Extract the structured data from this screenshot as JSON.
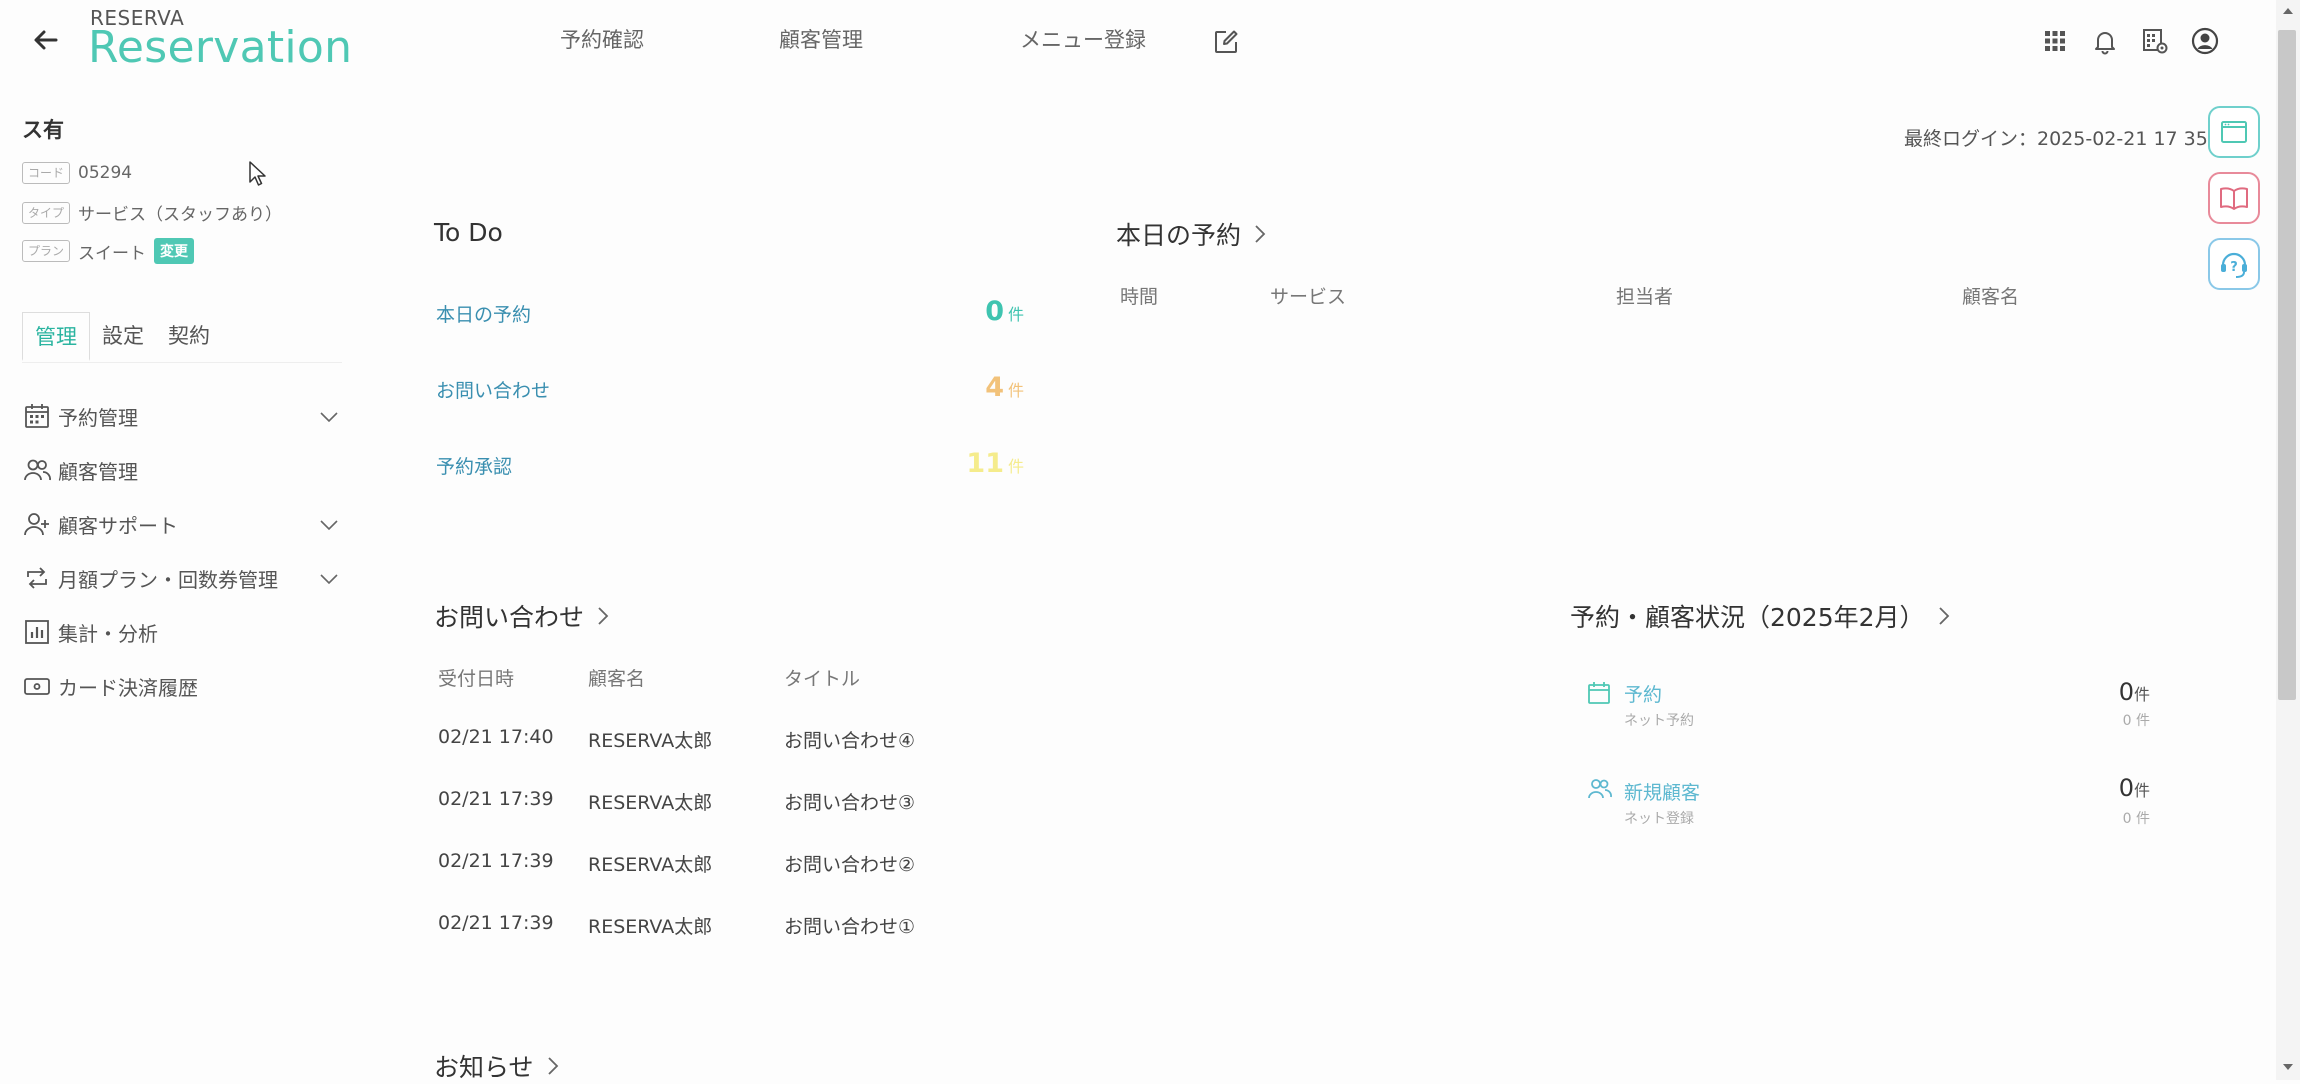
{
  "header": {
    "brand_small": "RESERVA",
    "brand_large": "Reservation",
    "nav": [
      "予約確認",
      "顧客管理",
      "メニュー登録"
    ]
  },
  "sidebar": {
    "shop_name": "ス有",
    "code_tag": "コード",
    "code_value": "05294",
    "type_tag": "タイプ",
    "type_value": "サービス（スタッフあり）",
    "plan_tag": "プラン",
    "plan_value": "スイート",
    "change_label": "変更",
    "tabs": [
      "管理",
      "設定",
      "契約"
    ],
    "menu": [
      {
        "label": "予約管理"
      },
      {
        "label": "顧客管理"
      },
      {
        "label": "顧客サポート"
      },
      {
        "label": "月額プラン・回数券管理"
      },
      {
        "label": "集計・分析"
      },
      {
        "label": "カード決済履歴"
      }
    ]
  },
  "main": {
    "last_login": "最終ログイン：2025-02-21 17 35",
    "todo": {
      "title": "To Do",
      "unit": "件",
      "items": [
        {
          "label": "本日の予約",
          "count": "0",
          "color": "#3fc4b0"
        },
        {
          "label": "お問い合わせ",
          "count": "4",
          "color": "#f2c27a"
        },
        {
          "label": "予約承認",
          "count": "11",
          "color": "#f5ec8c"
        }
      ]
    },
    "today": {
      "title": "本日の予約",
      "columns": [
        "時間",
        "サービス",
        "担当者",
        "顧客名"
      ]
    },
    "inquiries": {
      "title": "お問い合わせ",
      "columns": [
        "受付日時",
        "顧客名",
        "タイトル"
      ],
      "rows": [
        [
          "02/21 17:40",
          "RESERVA太郎",
          "お問い合わせ④"
        ],
        [
          "02/21 17:39",
          "RESERVA太郎",
          "お問い合わせ③"
        ],
        [
          "02/21 17:39",
          "RESERVA太郎",
          "お問い合わせ②"
        ],
        [
          "02/21 17:39",
          "RESERVA太郎",
          "お問い合わせ①"
        ]
      ]
    },
    "status": {
      "title": "予約・顧客状況（2025年2月）",
      "items": [
        {
          "label": "予約",
          "sub": "ネット予約",
          "count": "0",
          "unit": "件",
          "sub_count": "0 件"
        },
        {
          "label": "新規顧客",
          "sub": "ネット登録",
          "count": "0",
          "unit": "件",
          "sub_count": "0 件"
        }
      ]
    },
    "news": {
      "title": "お知らせ"
    }
  },
  "colors": {
    "accent": "#4fc8b4",
    "link": "#3a8fb0"
  }
}
